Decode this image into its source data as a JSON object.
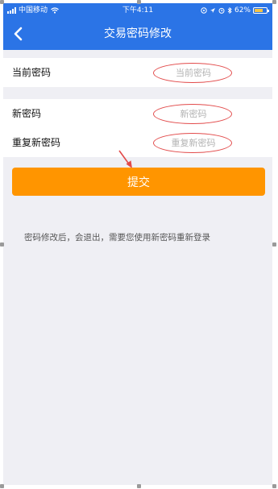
{
  "status_bar": {
    "carrier": "中国移动",
    "time": "下午4:11",
    "battery": "62%",
    "icons": [
      "signal-icon",
      "wifi-icon",
      "location-icon",
      "alarm-icon",
      "bluetooth-icon",
      "battery-icon"
    ]
  },
  "nav": {
    "title": "交易密码修改",
    "back_icon": "chevron-left-icon"
  },
  "form": {
    "current_password": {
      "label": "当前密码",
      "placeholder": "当前密码",
      "value": ""
    },
    "new_password": {
      "label": "新密码",
      "placeholder": "新密码",
      "value": ""
    },
    "repeat_password": {
      "label": "重复新密码",
      "placeholder": "重复新密码",
      "value": ""
    }
  },
  "submit": {
    "label": "提交"
  },
  "notice": "密码修改后，会退出，需要您使用新密码重新登录",
  "colors": {
    "primary": "#2b74e6",
    "accent": "#ff9500",
    "annotation": "#e24a4a",
    "background": "#efeff4"
  }
}
